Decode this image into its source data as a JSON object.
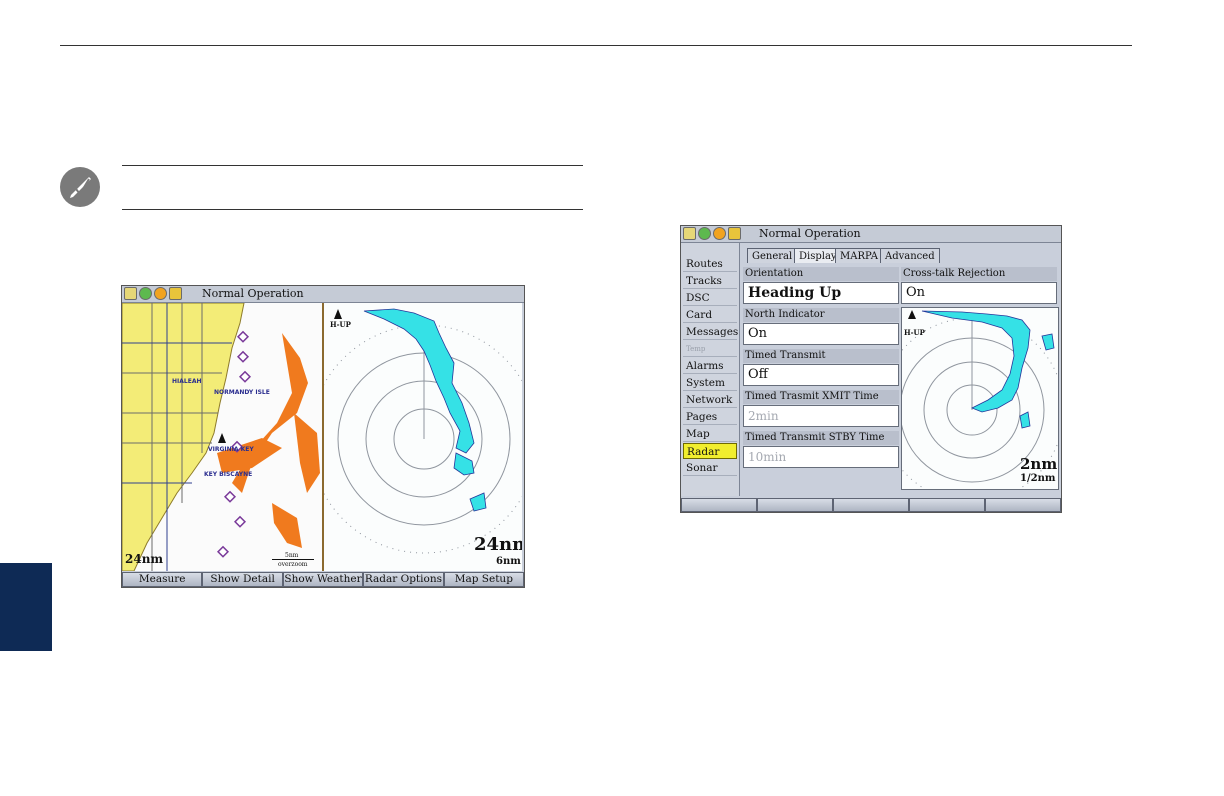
{
  "screen1": {
    "title": "Normal Operation",
    "map_range": "24nm",
    "scale_label": "5nm",
    "scale_sublabel": "overzoom",
    "place_labels": [
      "HIALEAH",
      "NORMANDY ISLE",
      "VIRGINIA KEY",
      "KEY BISCAYNE"
    ],
    "radar_orientation": "H-UP",
    "radar_range": "24nm",
    "radar_ring": "6nm",
    "softkeys": [
      "Measure",
      "Show Detail",
      "Show Weather",
      "Radar Options",
      "Map Setup"
    ]
  },
  "screen2": {
    "title": "Normal Operation",
    "sidebar": [
      {
        "label": "Routes"
      },
      {
        "label": "Tracks"
      },
      {
        "label": "DSC"
      },
      {
        "label": "Card"
      },
      {
        "label": "Messages"
      },
      {
        "label": "Temp"
      },
      {
        "label": "Alarms"
      },
      {
        "label": "System"
      },
      {
        "label": "Network"
      },
      {
        "label": "Pages"
      },
      {
        "label": "Map"
      },
      {
        "label": "Radar"
      },
      {
        "label": "Sonar"
      }
    ],
    "selected_sidebar": "Radar",
    "tabs": [
      "General",
      "Display",
      "MARPA",
      "Advanced"
    ],
    "fields": {
      "orientation": {
        "label": "Orientation",
        "value": "Heading Up"
      },
      "north_indicator": {
        "label": "North Indicator",
        "value": "On"
      },
      "timed_transmit": {
        "label": "Timed Transmit",
        "value": "Off"
      },
      "xmit_time": {
        "label": "Timed Trasmit XMIT Time",
        "value": "2min"
      },
      "stby_time": {
        "label": "Timed Transmit STBY Time",
        "value": "10min"
      },
      "crosstalk": {
        "label": "Cross-talk Rejection",
        "value": "On"
      }
    },
    "radar_orientation": "H-UP",
    "radar_range": "2nm",
    "radar_ring": "1/2nm",
    "softkeys": [
      "",
      "",
      "",
      "",
      ""
    ]
  },
  "colors": {
    "selection": "#f1ee2e",
    "land": "#f3ec77",
    "weather": "#f07a1e",
    "radar_return": "#35e1e6",
    "page_tab": "#0e2a55"
  }
}
